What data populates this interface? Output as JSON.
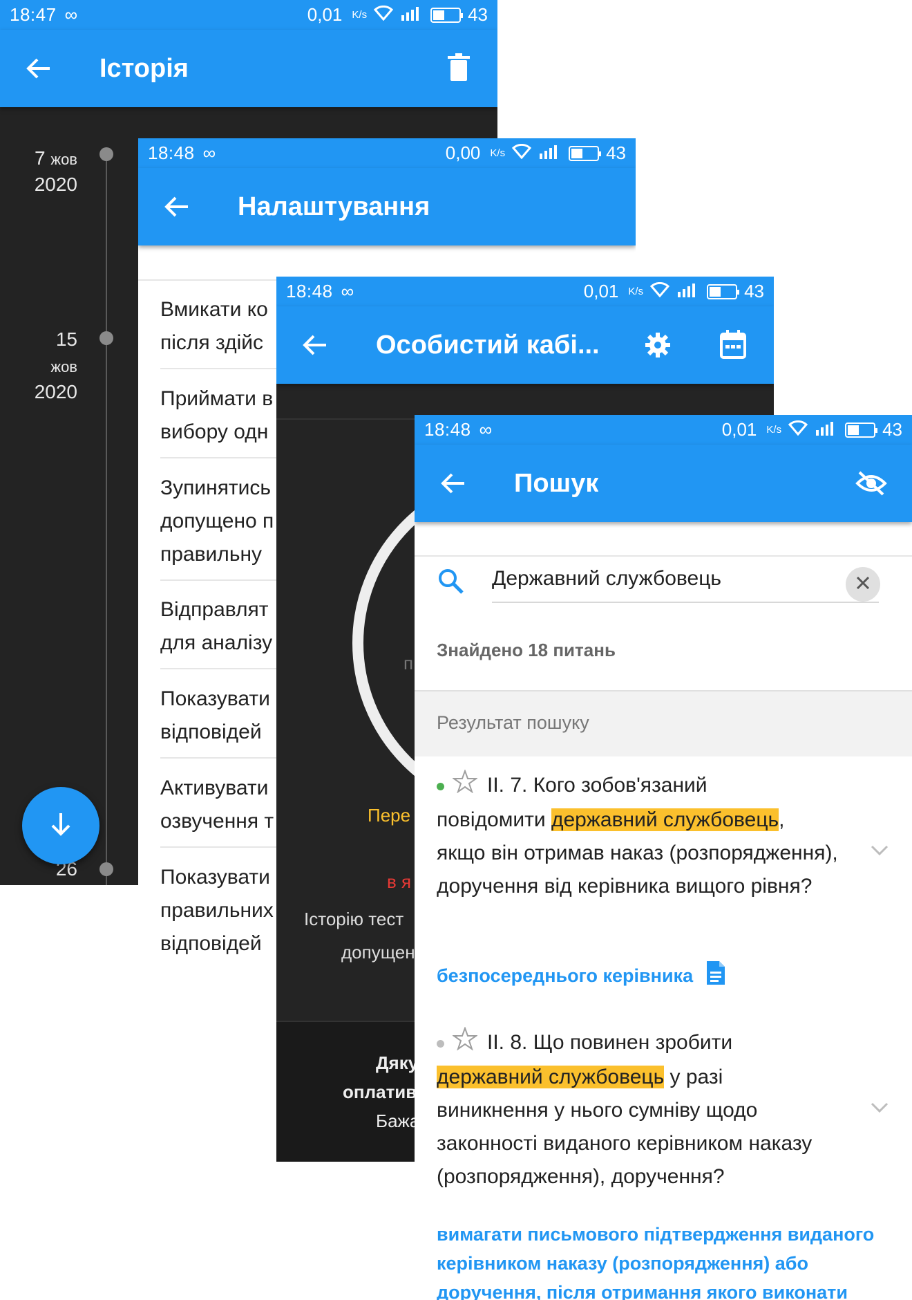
{
  "screens": {
    "history": {
      "status": {
        "time": "18:47",
        "speed": "0,01",
        "unit": "K/s",
        "battery": "43"
      },
      "title": "Історія",
      "timeline": [
        {
          "day": "7",
          "month": "жов",
          "year": "2020"
        },
        {
          "day": "15",
          "month": "жов",
          "year": "2020"
        },
        {
          "day": "26",
          "month": "",
          "year": ""
        }
      ]
    },
    "settings": {
      "status": {
        "time": "18:48",
        "speed": "0,00",
        "unit": "K/s",
        "battery": "43"
      },
      "title": "Налаштування",
      "items": [
        {
          "line1": "Вмикати ко",
          "line2": "після здійс"
        },
        {
          "line1": "Приймати в",
          "line2": "вибору одн"
        },
        {
          "line1": "Зупинятись",
          "line2": "допущено п",
          "line3": "правильну"
        },
        {
          "line1": "Відправлят",
          "line2": "для аналізу"
        },
        {
          "line1": "Показувати",
          "line2": "відповідей"
        },
        {
          "line1": "Активувати",
          "line2": "озвучення т"
        },
        {
          "line1": "Показувати",
          "line2": "правильних",
          "line3": "відповідей"
        }
      ]
    },
    "cabinet": {
      "status": {
        "time": "18:48",
        "speed": "0,01",
        "unit": "K/s",
        "battery": "43"
      },
      "title": "Особистий кабі...",
      "circle_label": "п",
      "orange_text": "Пере",
      "red_text": "в я",
      "history_text": "Історію тест",
      "history_text2": "допущен",
      "thanks1": "Дяку",
      "thanks2": "оплатив",
      "thanks3": "Бажа"
    },
    "search": {
      "status": {
        "time": "18:48",
        "speed": "0,01",
        "unit": "K/s",
        "battery": "43"
      },
      "title": "Пошук",
      "query": "Державний службовець",
      "found": "Знайдено 18 питань",
      "results_header": "Результат пошуку",
      "questions": [
        {
          "dot_color": "#4caf50",
          "prefix": "ІІ. 7. Кого зобов'язаний",
          "pre_hl": "повідомити ",
          "highlight": "державний службовець",
          "post_hl": ",",
          "rest": "якщо він отримав наказ (розпорядження), доручення від керівника вищого рівня?",
          "answer": "безпосереднього керівника"
        },
        {
          "dot_color": "#bdbdbd",
          "prefix": "ІІ. 8. Що повинен зробити",
          "pre_hl": "",
          "highlight": "державний службовець",
          "post_hl": " у разі",
          "rest": "виникнення у нього сумніву щодо законності виданого керівником наказу (розпорядження), доручення?",
          "answer": "вимагати письмового підтвердження виданого керівником наказу (розпорядження) або доручення, після отримання якого виконати"
        }
      ]
    }
  },
  "colors": {
    "primary": "#2196f3",
    "highlight": "#fbc02d",
    "dark_bg": "#232323"
  }
}
